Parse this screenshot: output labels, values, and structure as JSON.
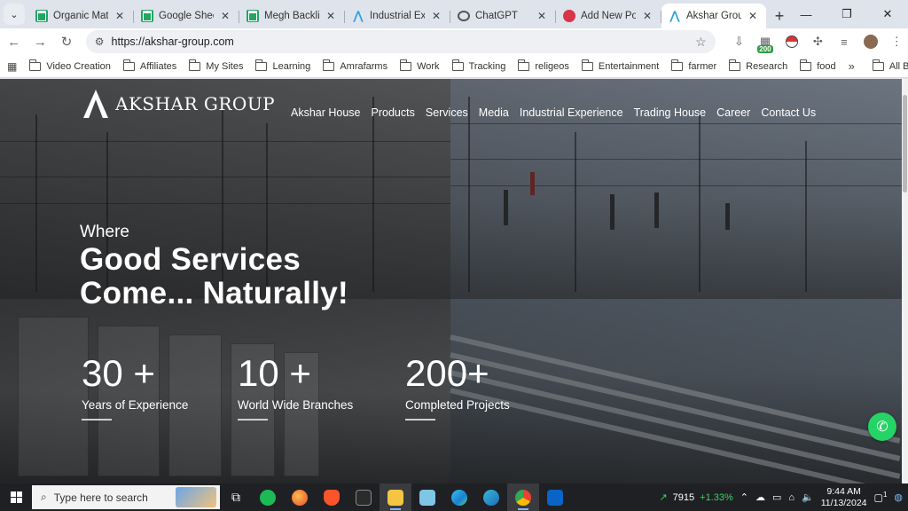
{
  "tabs": [
    {
      "title": "Organic Mattres",
      "icon": "google-sheets-icon"
    },
    {
      "title": "Google Sheets",
      "icon": "google-sheets-icon"
    },
    {
      "title": "Megh Backlinks",
      "icon": "google-sheets-icon"
    },
    {
      "title": "Industrial Experi",
      "icon": "akshar-icon"
    },
    {
      "title": "ChatGPT",
      "icon": "chatgpt-icon"
    },
    {
      "title": "Add New Post ‹",
      "icon": "wordpress-icon"
    },
    {
      "title": "Akshar Group",
      "icon": "akshar-icon"
    }
  ],
  "address_bar": {
    "url": "https://akshar-group.com"
  },
  "extensions": {
    "badge": "200"
  },
  "bookmarks": [
    "Video Creation",
    "Affiliates",
    "My Sites",
    "Learning",
    "Amrafarms",
    "Work",
    "Tracking",
    "religeos",
    "Entertainment",
    "farmer",
    "Research",
    "food"
  ],
  "all_bookmarks_label": "All Bookmarks",
  "site": {
    "logo_text": "AKSHAR GROUP",
    "nav": [
      "Akshar House",
      "Products",
      "Services",
      "Media",
      "Industrial Experience",
      "Trading House",
      "Career",
      "Contact Us"
    ],
    "hero_small": "Where",
    "hero_line1": "Good Services",
    "hero_line2": "Come... Naturally!",
    "stats": [
      {
        "value": "30 +",
        "label": "Years of Experience"
      },
      {
        "value": "10 +",
        "label": "World Wide Branches"
      },
      {
        "value": "200+",
        "label": "Completed Projects"
      }
    ]
  },
  "taskbar": {
    "search_placeholder": "Type here to search",
    "stock_value": "7915",
    "stock_change": "+1.33%",
    "time": "9:44 AM",
    "date": "11/13/2024",
    "notification_count": "1"
  }
}
